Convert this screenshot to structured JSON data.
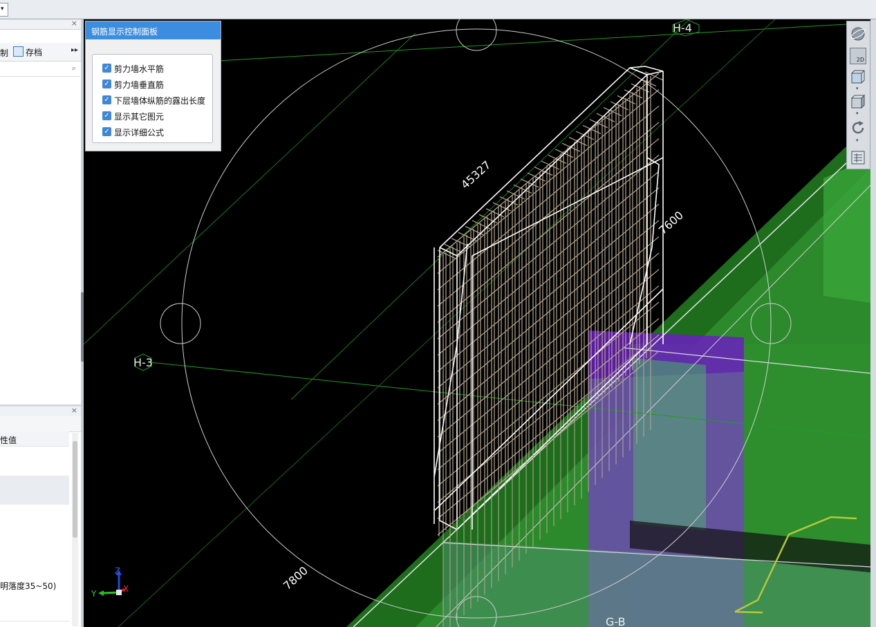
{
  "left_panel": {
    "partial_tool_label": "制",
    "archive_label": "存档",
    "more_icon": "double-chevron-right-icon",
    "search_icon": "search-icon",
    "property_header": "性值",
    "property_note": "明落度35~50)"
  },
  "rebar_panel": {
    "title": "钢筋显示控制面板",
    "options": [
      {
        "label": "剪力墙水平筋",
        "checked": true
      },
      {
        "label": "剪力墙垂直筋",
        "checked": true
      },
      {
        "label": "下层墙体纵筋的露出长度",
        "checked": true
      },
      {
        "label": "显示其它图元",
        "checked": true
      },
      {
        "label": "显示详细公式",
        "checked": true
      }
    ]
  },
  "viewport": {
    "axis_labels": {
      "h4": "H-4",
      "h3": "H-3",
      "gb": "G-B"
    },
    "dimensions": {
      "top": "45327",
      "right": "7600",
      "left": "7800"
    },
    "gizmo": {
      "z": "Z",
      "y": "Y",
      "x": "X"
    }
  },
  "view_toolbar": {
    "icons": [
      "orbit-sphere-icon",
      "2d-view-icon",
      "front-box-view-icon",
      "3d-box-view-icon",
      "rotate-icon",
      "display-settings-icon"
    ],
    "label_2d": "2D"
  },
  "colors": {
    "panel_title_bg": "#3c8de0",
    "checkbox": "#3f87d8",
    "slab_green": "#2c8a2c",
    "purple": "#6a1fc0",
    "grid_line": "#1e9e1e"
  }
}
